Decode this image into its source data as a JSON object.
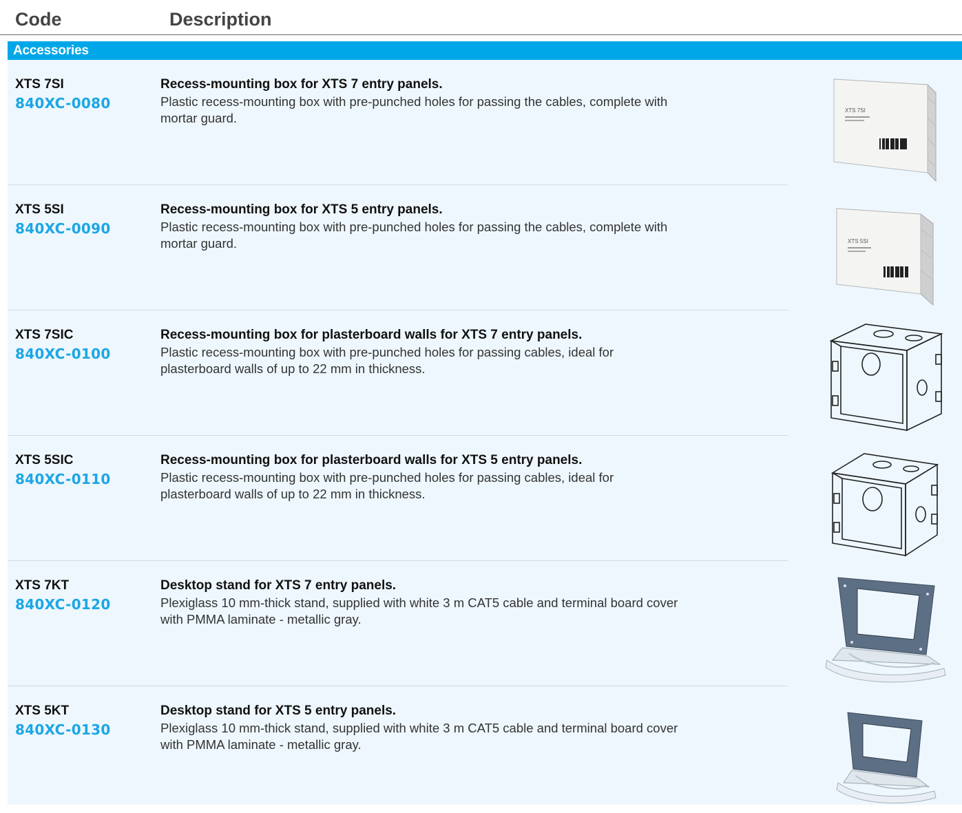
{
  "header": {
    "code_label": "Code",
    "description_label": "Description"
  },
  "section": {
    "title": "Accessories"
  },
  "colors": {
    "accent": "#00a7e8",
    "code_text": "#1ba6e6",
    "row_background": "#eef7fd"
  },
  "items": [
    {
      "name": "XTS 7SI",
      "code": "840XC-0080",
      "title": "Recess-mounting box for XTS 7 entry panels.",
      "description": "Plastic recess-mounting box with pre-punched holes for passing the cables, complete with mortar guard.",
      "image_label": "XTS 7SI",
      "image_type": "closed-box"
    },
    {
      "name": "XTS 5SI",
      "code": "840XC-0090",
      "title": "Recess-mounting box for XTS 5 entry panels.",
      "description": "Plastic recess-mounting box with pre-punched holes for passing the cables, complete with mortar guard.",
      "image_label": "XTS 5SI",
      "image_type": "closed-box"
    },
    {
      "name": "XTS 7SIC",
      "code": "840XC-0100",
      "title": "Recess-mounting box for plasterboard walls for XTS 7 entry panels.",
      "description": "Plastic recess-mounting box with pre-punched holes for passing cables, ideal for plasterboard walls of up to 22 mm in thickness.",
      "image_type": "open-box"
    },
    {
      "name": "XTS 5SIC",
      "code": "840XC-0110",
      "title": "Recess-mounting box for plasterboard walls for XTS 5 entry panels.",
      "description": "Plastic recess-mounting box with pre-punched holes for passing cables, ideal for plasterboard walls of up to 22 mm in thickness.",
      "image_type": "open-box"
    },
    {
      "name": "XTS 7KT",
      "code": "840XC-0120",
      "title": "Desktop stand for XTS 7 entry panels.",
      "description": "Plexiglass 10 mm-thick stand, supplied with white 3 m CAT5 cable and terminal board cover with PMMA laminate - metallic gray.",
      "image_type": "desk-stand"
    },
    {
      "name": "XTS 5KT",
      "code": "840XC-0130",
      "title": "Desktop stand for XTS 5 entry panels.",
      "description": "Plexiglass 10 mm-thick stand, supplied with white 3 m CAT5 cable and terminal board cover with PMMA laminate - metallic gray.",
      "image_type": "desk-stand"
    }
  ]
}
